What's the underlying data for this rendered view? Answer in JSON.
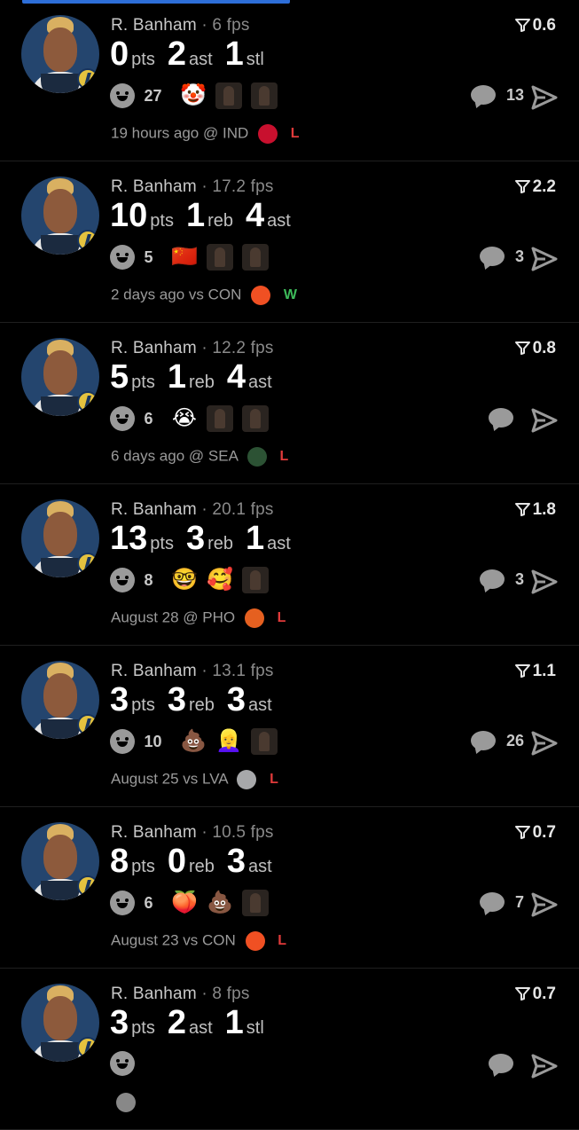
{
  "cards": [
    {
      "player": "R. Banham",
      "fps": "6 fps",
      "score": "0.6",
      "stats": [
        {
          "num": "0",
          "unit": "pts"
        },
        {
          "num": "2",
          "unit": "ast"
        },
        {
          "num": "1",
          "unit": "stl"
        }
      ],
      "smiley_count": "27",
      "reactions": [
        "🤡",
        "thumb",
        "thumb"
      ],
      "comments": "13",
      "time": "19 hours ago",
      "venue": "@ IND",
      "team_color": "#c8102e",
      "result": "L"
    },
    {
      "player": "R. Banham",
      "fps": "17.2 fps",
      "score": "2.2",
      "stats": [
        {
          "num": "10",
          "unit": "pts"
        },
        {
          "num": "1",
          "unit": "reb"
        },
        {
          "num": "4",
          "unit": "ast"
        }
      ],
      "smiley_count": "5",
      "reactions": [
        "🇨🇳",
        "thumb",
        "thumb"
      ],
      "comments": "3",
      "time": "2 days ago",
      "venue": "vs CON",
      "team_color": "#f05023",
      "result": "W"
    },
    {
      "player": "R. Banham",
      "fps": "12.2 fps",
      "score": "0.8",
      "stats": [
        {
          "num": "5",
          "unit": "pts"
        },
        {
          "num": "1",
          "unit": "reb"
        },
        {
          "num": "4",
          "unit": "ast"
        }
      ],
      "smiley_count": "6",
      "reactions": [
        "😭",
        "thumb",
        "thumb"
      ],
      "comments": "",
      "time": "6 days ago",
      "venue": "@ SEA",
      "team_color": "#2c5234",
      "result": "L"
    },
    {
      "player": "R. Banham",
      "fps": "20.1 fps",
      "score": "1.8",
      "stats": [
        {
          "num": "13",
          "unit": "pts"
        },
        {
          "num": "3",
          "unit": "reb"
        },
        {
          "num": "1",
          "unit": "ast"
        }
      ],
      "smiley_count": "8",
      "reactions": [
        "🤓",
        "🥰",
        "thumb"
      ],
      "comments": "3",
      "time": "August 28",
      "venue": "@ PHO",
      "team_color": "#e56020",
      "result": "L"
    },
    {
      "player": "R. Banham",
      "fps": "13.1 fps",
      "score": "1.1",
      "stats": [
        {
          "num": "3",
          "unit": "pts"
        },
        {
          "num": "3",
          "unit": "reb"
        },
        {
          "num": "3",
          "unit": "ast"
        }
      ],
      "smiley_count": "10",
      "reactions": [
        "💩",
        "👱‍♀️",
        "thumb"
      ],
      "comments": "26",
      "time": "August 25",
      "venue": "vs LVA",
      "team_color": "#a7a8aa",
      "result": "L"
    },
    {
      "player": "R. Banham",
      "fps": "10.5 fps",
      "score": "0.7",
      "stats": [
        {
          "num": "8",
          "unit": "pts"
        },
        {
          "num": "0",
          "unit": "reb"
        },
        {
          "num": "3",
          "unit": "ast"
        }
      ],
      "smiley_count": "6",
      "reactions": [
        "🍑",
        "💩",
        "thumb"
      ],
      "comments": "7",
      "time": "August 23",
      "venue": "vs CON",
      "team_color": "#f05023",
      "result": "L"
    },
    {
      "player": "R. Banham",
      "fps": "8 fps",
      "score": "0.7",
      "stats": [
        {
          "num": "3",
          "unit": "pts"
        },
        {
          "num": "2",
          "unit": "ast"
        },
        {
          "num": "1",
          "unit": "stl"
        }
      ],
      "smiley_count": "",
      "reactions": [],
      "comments": "",
      "time": "",
      "venue": "",
      "team_color": "#888888",
      "result": ""
    }
  ]
}
